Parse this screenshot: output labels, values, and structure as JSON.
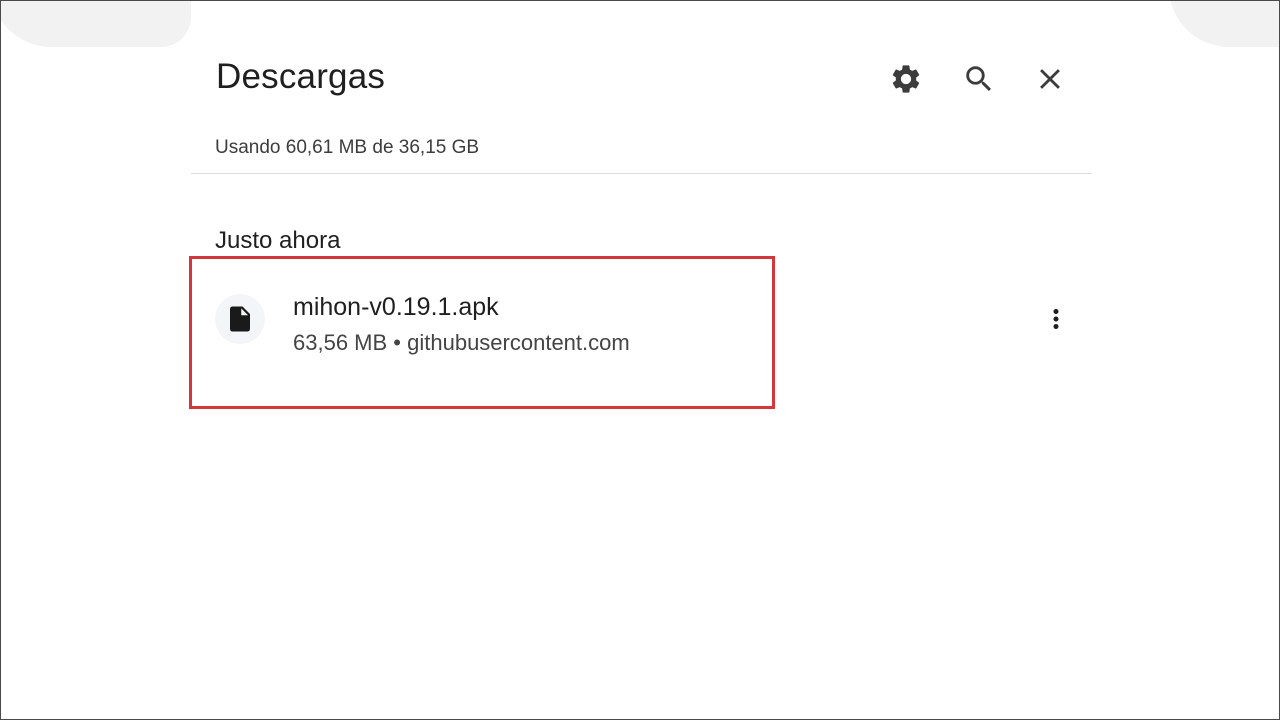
{
  "header": {
    "title": "Descargas",
    "settings_icon": "gear-icon",
    "search_icon": "search-icon",
    "close_icon": "close-icon"
  },
  "storage": {
    "text": "Usando 60,61 MB de 36,15 GB"
  },
  "sections": [
    {
      "label": "Justo ahora",
      "items": [
        {
          "file_name": "mihon-v0.19.1.apk",
          "size": "63,56 MB",
          "separator": "•",
          "source": "githubusercontent.com",
          "icon": "file-icon",
          "menu_icon": "more-vert-icon"
        }
      ]
    }
  ],
  "colors": {
    "highlight": "#d3363b",
    "icon": "#3c3c3c",
    "text_primary": "#1f1f1f"
  }
}
